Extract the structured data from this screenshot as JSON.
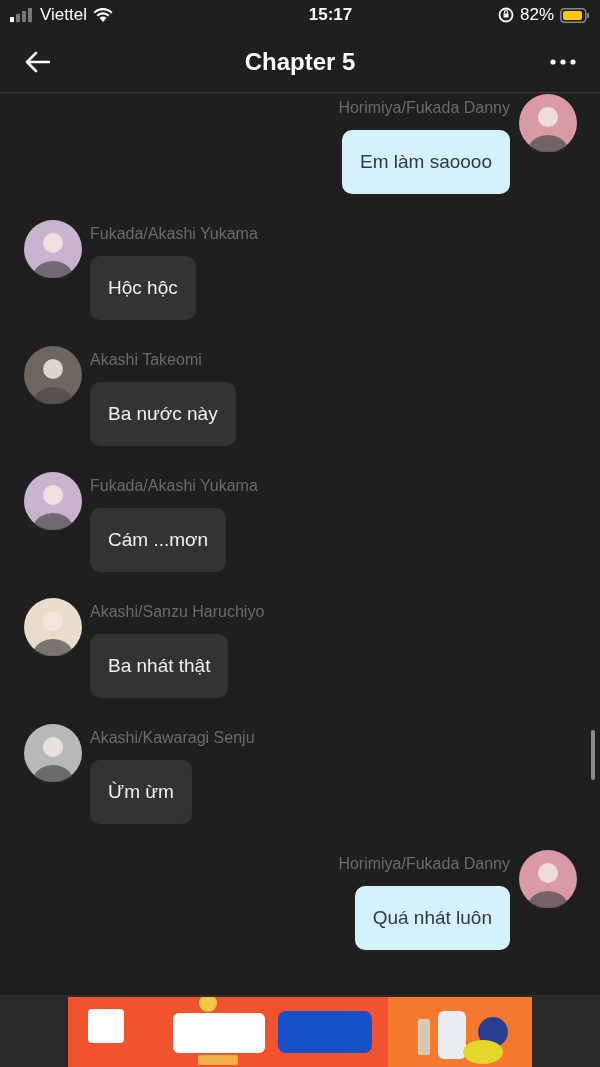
{
  "status_bar": {
    "carrier": "Viettel",
    "time": "15:17",
    "battery": "82%"
  },
  "header": {
    "title": "Chapter 5"
  },
  "messages": [
    {
      "kind": "outgoing",
      "author": "Horimiya/Fukada Danny",
      "text": "Em làm saoooo",
      "color": "#d99aa6"
    },
    {
      "kind": "incoming",
      "author": "Fukada/Akashi Yukama",
      "text": "Hộc hộc",
      "color": "#c9b3cf"
    },
    {
      "kind": "incoming",
      "author": "Akashi Takeomi",
      "text": "Ba nước này",
      "color": "#6e6660"
    },
    {
      "kind": "incoming",
      "author": "Fukada/Akashi Yukama",
      "text": "Cám ...mơn",
      "color": "#c9b3cf"
    },
    {
      "kind": "incoming",
      "author": "Akashi/Sanzu Haruchiyo",
      "text": "Ba nhát thật",
      "color": "#e8dccb"
    },
    {
      "kind": "incoming",
      "author": "Akashi/Kawaragi Senju",
      "text": "Ừm ừm",
      "color": "#b8b8b8"
    },
    {
      "kind": "outgoing",
      "author": "Horimiya/Fukada Danny",
      "text": "Quá nhát luôn",
      "color": "#d99aa6"
    }
  ]
}
